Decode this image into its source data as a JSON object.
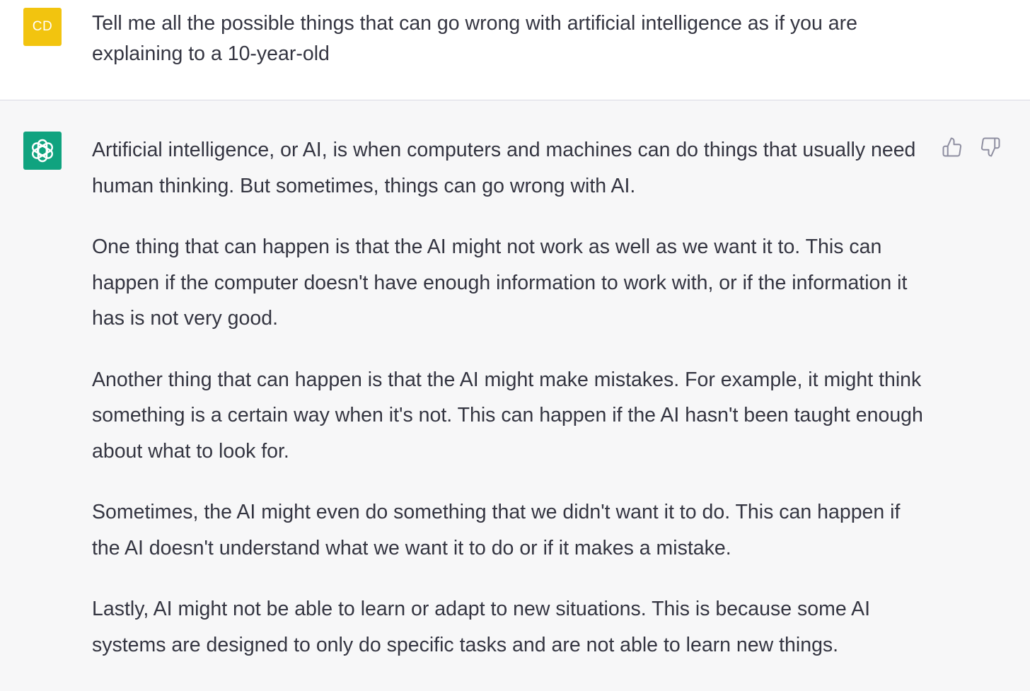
{
  "user_message": {
    "avatar_initials": "CD",
    "avatar_color": "#f2c40f",
    "text": "Tell me all the possible things that can go wrong with artificial intelligence as if you are explaining to a 10-year-old"
  },
  "assistant_message": {
    "avatar_icon": "openai-logo-icon",
    "avatar_color": "#10a37f",
    "paragraphs": [
      "Artificial intelligence, or AI, is when computers and machines can do things that usually need human thinking. But sometimes, things can go wrong with AI.",
      "One thing that can happen is that the AI might not work as well as we want it to. This can happen if the computer doesn't have enough information to work with, or if the information it has is not very good.",
      "Another thing that can happen is that the AI might make mistakes. For example, it might think something is a certain way when it's not. This can happen if the AI hasn't been taught enough about what to look for.",
      "Sometimes, the AI might even do something that we didn't want it to do. This can happen if the AI doesn't understand what we want it to do or if it makes a mistake.",
      "Lastly, AI might not be able to learn or adapt to new situations. This is because some AI systems are designed to only do specific tasks and are not able to learn new things."
    ],
    "feedback_icons": [
      "thumbs-up-icon",
      "thumbs-down-icon"
    ]
  }
}
